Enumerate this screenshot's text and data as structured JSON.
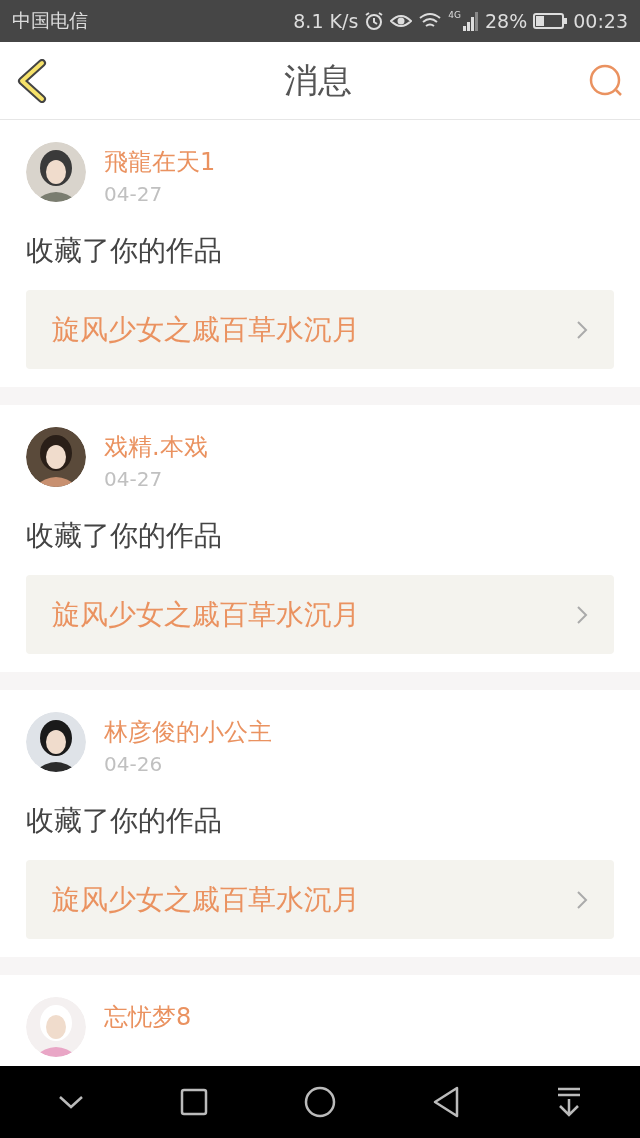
{
  "status_bar": {
    "carrier": "中国电信",
    "speed": "8.1 K/s",
    "network": "4G",
    "battery": "28%",
    "time": "00:23"
  },
  "header": {
    "title": "消息"
  },
  "messages": [
    {
      "user": "飛龍在天1",
      "date": "04-27",
      "text": "收藏了你的作品",
      "work": "旋风少女之戚百草水沉月"
    },
    {
      "user": "戏精.本戏",
      "date": "04-27",
      "text": "收藏了你的作品",
      "work": "旋风少女之戚百草水沉月"
    },
    {
      "user": "林彦俊的小公主",
      "date": "04-26",
      "text": "收藏了你的作品",
      "work": "旋风少女之戚百草水沉月"
    },
    {
      "user": "忘忧梦8"
    }
  ]
}
